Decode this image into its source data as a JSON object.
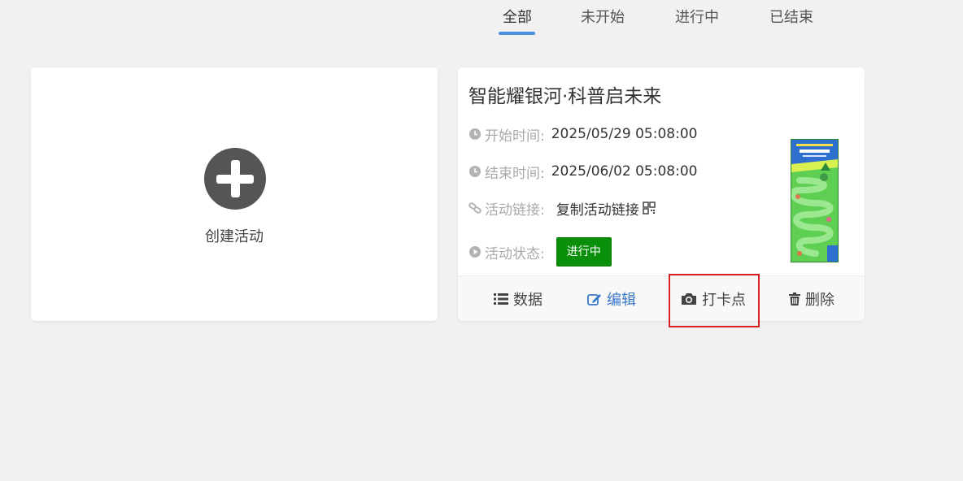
{
  "tabs": [
    {
      "label": "全部"
    },
    {
      "label": "未开始"
    },
    {
      "label": "进行中"
    },
    {
      "label": "已结束"
    }
  ],
  "create_card": {
    "label": "创建活动"
  },
  "activity": {
    "title": "智能耀银河·科普启未来",
    "start_label": "开始时间:",
    "start_value": "2025/05/29 05:08:00",
    "end_label": "结束时间:",
    "end_value": "2025/06/02 05:08:00",
    "link_label": "活动链接:",
    "link_value": "复制活动链接",
    "status_label": "活动状态:",
    "status_value": "进行中",
    "status_color": "#0a8f0a"
  },
  "footer": {
    "data_label": "数据",
    "edit_label": "编辑",
    "checkin_label": "打卡点",
    "delete_label": "删除"
  },
  "colors": {
    "accent": "#4a90e2",
    "edit": "#3a78c9",
    "highlight": "#d82020"
  }
}
